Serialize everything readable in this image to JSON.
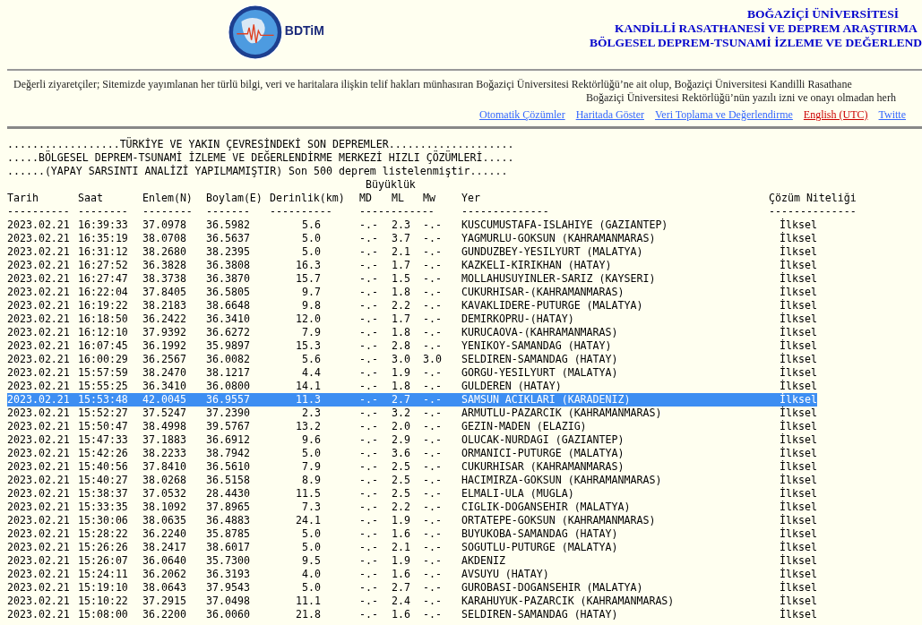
{
  "header": {
    "logo_text": "BDTiM",
    "titles": [
      "BOĞAZİÇİ ÜNİVERSİTESİ",
      "KANDİLLİ RASATHANESİ VE DEPREM ARAŞTIRMA",
      "BÖLGESEL DEPREM-TSUNAMİ İZLEME VE DEĞERLEND"
    ]
  },
  "notice": [
    "Değerli ziyaretçiler; Sitemizde yayımlanan her türlü bilgi, veri ve haritalara ilişkin telif hakları münhasıran Boğaziçi Üniversitesi Rektörlüğü’ne ait olup, Boğaziçi Üniversitesi Kandilli Rasathane",
    "Boğaziçi Üniversitesi Rektörlüğü’nün yazılı izni ve onayı olmadan herh"
  ],
  "links": [
    {
      "label": "Otomatik Çözümler",
      "kind": "nav"
    },
    {
      "label": "Haritada Göster",
      "kind": "nav"
    },
    {
      "label": "Veri Toplama ve Değerlendirme",
      "kind": "nav"
    },
    {
      "label": "English (UTC)",
      "kind": "language"
    },
    {
      "label": "Twitte",
      "kind": "nav"
    }
  ],
  "list_titles": [
    "..................TÜRKİYE VE YAKIN ÇEVRESİNDEKİ SON DEPREMLER....................",
    ".....BÖLGESEL DEPREM-TSUNAMİ İZLEME VE DEĞERLENDİRME MERKEZİ HIZLI ÇÖZÜMLERİ.....",
    "......(YAPAY SARSINTI ANALİZİ YAPILMAMIŞTIR) Son 500 deprem listelenmiştir......"
  ],
  "table": {
    "group_header": "Büyüklük",
    "columns": [
      "Tarih",
      "Saat",
      "Enlem(N)",
      "Boylam(E)",
      "Derinlik(km)",
      "MD",
      "ML",
      "Mw",
      "Yer",
      "Çözüm Niteliği"
    ],
    "separators": [
      "----------",
      "--------",
      "--------",
      "-------",
      "----------",
      "------------",
      "--------------",
      "--------------"
    ],
    "rows": [
      {
        "cells": [
          "2023.02.21",
          "16:39:33",
          "37.0978",
          "36.5982",
          "5.6",
          "-.-",
          "2.3",
          "-.-",
          "KUSCUMUSTAFA-ISLAHIYE (GAZIANTEP)",
          "İlksel"
        ],
        "selected": false
      },
      {
        "cells": [
          "2023.02.21",
          "16:35:19",
          "38.0708",
          "36.5637",
          "5.0",
          "-.-",
          "3.7",
          "-.-",
          "YAGMURLU-GOKSUN (KAHRAMANMARAS)",
          "İlksel"
        ],
        "selected": false
      },
      {
        "cells": [
          "2023.02.21",
          "16:31:12",
          "38.2680",
          "38.2395",
          "5.0",
          "-.-",
          "2.1",
          "-.-",
          "GUNDUZBEY-YESILYURT (MALATYA)",
          "İlksel"
        ],
        "selected": false
      },
      {
        "cells": [
          "2023.02.21",
          "16:27:52",
          "36.3828",
          "36.3808",
          "16.3",
          "-.-",
          "1.7",
          "-.-",
          "KAZKELI-KIRIKHAN (HATAY)",
          "İlksel"
        ],
        "selected": false
      },
      {
        "cells": [
          "2023.02.21",
          "16:27:47",
          "38.3738",
          "36.3870",
          "15.7",
          "-.-",
          "1.5",
          "-.-",
          "MOLLAHUSUYINLER-SARIZ (KAYSERI)",
          "İlksel"
        ],
        "selected": false
      },
      {
        "cells": [
          "2023.02.21",
          "16:22:04",
          "37.8405",
          "36.5805",
          "9.7",
          "-.-",
          "1.8",
          "-.-",
          "CUKURHISAR-(KAHRAMANMARAS)",
          "İlksel"
        ],
        "selected": false
      },
      {
        "cells": [
          "2023.02.21",
          "16:19:22",
          "38.2183",
          "38.6648",
          "9.8",
          "-.-",
          "2.2",
          "-.-",
          "KAVAKLIDERE-PUTURGE (MALATYA)",
          "İlksel"
        ],
        "selected": false
      },
      {
        "cells": [
          "2023.02.21",
          "16:18:50",
          "36.2422",
          "36.3410",
          "12.0",
          "-.-",
          "1.7",
          "-.-",
          "DEMIRKOPRU-(HATAY)",
          "İlksel"
        ],
        "selected": false
      },
      {
        "cells": [
          "2023.02.21",
          "16:12:10",
          "37.9392",
          "36.6272",
          "7.9",
          "-.-",
          "1.8",
          "-.-",
          "KURUCAOVA-(KAHRAMANMARAS)",
          "İlksel"
        ],
        "selected": false
      },
      {
        "cells": [
          "2023.02.21",
          "16:07:45",
          "36.1992",
          "35.9897",
          "15.3",
          "-.-",
          "2.8",
          "-.-",
          "YENIKOY-SAMANDAG (HATAY)",
          "İlksel"
        ],
        "selected": false
      },
      {
        "cells": [
          "2023.02.21",
          "16:00:29",
          "36.2567",
          "36.0082",
          "5.6",
          "-.-",
          "3.0",
          "3.0",
          "SELDIREN-SAMANDAG (HATAY)",
          "İlksel"
        ],
        "selected": false
      },
      {
        "cells": [
          "2023.02.21",
          "15:57:59",
          "38.2470",
          "38.1217",
          "4.4",
          "-.-",
          "1.9",
          "-.-",
          "GORGU-YESILYURT (MALATYA)",
          "İlksel"
        ],
        "selected": false
      },
      {
        "cells": [
          "2023.02.21",
          "15:55:25",
          "36.3410",
          "36.0800",
          "14.1",
          "-.-",
          "1.8",
          "-.-",
          "GULDEREN (HATAY)",
          "İlksel"
        ],
        "selected": false
      },
      {
        "cells": [
          "2023.02.21",
          "15:53:48",
          "42.0045",
          "36.9557",
          "11.3",
          "-.-",
          "2.7",
          "-.-",
          "SAMSUN ACIKLARI (KARADENIZ)",
          "İlksel"
        ],
        "selected": true
      },
      {
        "cells": [
          "2023.02.21",
          "15:52:27",
          "37.5247",
          "37.2390",
          "2.3",
          "-.-",
          "3.2",
          "-.-",
          "ARMUTLU-PAZARCIK (KAHRAMANMARAS)",
          "İlksel"
        ],
        "selected": false
      },
      {
        "cells": [
          "2023.02.21",
          "15:50:47",
          "38.4998",
          "39.5767",
          "13.2",
          "-.-",
          "2.0",
          "-.-",
          "GEZIN-MADEN (ELAZIG)",
          "İlksel"
        ],
        "selected": false
      },
      {
        "cells": [
          "2023.02.21",
          "15:47:33",
          "37.1883",
          "36.6912",
          "9.6",
          "-.-",
          "2.9",
          "-.-",
          "OLUCAK-NURDAGI (GAZIANTEP)",
          "İlksel"
        ],
        "selected": false
      },
      {
        "cells": [
          "2023.02.21",
          "15:42:26",
          "38.2233",
          "38.7942",
          "5.0",
          "-.-",
          "3.6",
          "-.-",
          "ORMANICI-PUTURGE (MALATYA)",
          "İlksel"
        ],
        "selected": false
      },
      {
        "cells": [
          "2023.02.21",
          "15:40:56",
          "37.8410",
          "36.5610",
          "7.9",
          "-.-",
          "2.5",
          "-.-",
          "CUKURHISAR (KAHRAMANMARAS)",
          "İlksel"
        ],
        "selected": false
      },
      {
        "cells": [
          "2023.02.21",
          "15:40:27",
          "38.0268",
          "36.5158",
          "8.9",
          "-.-",
          "2.5",
          "-.-",
          "HACIMIRZA-GOKSUN (KAHRAMANMARAS)",
          "İlksel"
        ],
        "selected": false
      },
      {
        "cells": [
          "2023.02.21",
          "15:38:37",
          "37.0532",
          "28.4430",
          "11.5",
          "-.-",
          "2.5",
          "-.-",
          "ELMALI-ULA (MUGLA)",
          "İlksel"
        ],
        "selected": false
      },
      {
        "cells": [
          "2023.02.21",
          "15:33:35",
          "38.1092",
          "37.8965",
          "7.3",
          "-.-",
          "2.2",
          "-.-",
          "CIGLIK-DOGANSEHIR (MALATYA)",
          "İlksel"
        ],
        "selected": false
      },
      {
        "cells": [
          "2023.02.21",
          "15:30:06",
          "38.0635",
          "36.4883",
          "24.1",
          "-.-",
          "1.9",
          "-.-",
          "ORTATEPE-GOKSUN (KAHRAMANMARAS)",
          "İlksel"
        ],
        "selected": false
      },
      {
        "cells": [
          "2023.02.21",
          "15:28:22",
          "36.2240",
          "35.8785",
          "5.0",
          "-.-",
          "1.6",
          "-.-",
          "BUYUKOBA-SAMANDAG (HATAY)",
          "İlksel"
        ],
        "selected": false
      },
      {
        "cells": [
          "2023.02.21",
          "15:26:26",
          "38.2417",
          "38.6017",
          "5.0",
          "-.-",
          "2.1",
          "-.-",
          "SOGUTLU-PUTURGE (MALATYA)",
          "İlksel"
        ],
        "selected": false
      },
      {
        "cells": [
          "2023.02.21",
          "15:26:07",
          "36.0640",
          "35.7300",
          "9.5",
          "-.-",
          "1.9",
          "-.-",
          "AKDENIZ",
          "İlksel"
        ],
        "selected": false
      },
      {
        "cells": [
          "2023.02.21",
          "15:24:11",
          "36.2062",
          "36.3193",
          "4.0",
          "-.-",
          "1.6",
          "-.-",
          "AVSUYU (HATAY)",
          "İlksel"
        ],
        "selected": false
      },
      {
        "cells": [
          "2023.02.21",
          "15:19:10",
          "38.0643",
          "37.9543",
          "5.0",
          "-.-",
          "2.7",
          "-.-",
          "GUROBASI-DOGANSEHIR (MALATYA)",
          "İlksel"
        ],
        "selected": false
      },
      {
        "cells": [
          "2023.02.21",
          "15:10:22",
          "37.2915",
          "37.0498",
          "11.1",
          "-.-",
          "2.4",
          "-.-",
          "KARAHUYUK-PAZARCIK (KAHRAMANMARAS)",
          "İlksel"
        ],
        "selected": false
      },
      {
        "cells": [
          "2023.02.21",
          "15:08:00",
          "36.2200",
          "36.0060",
          "21.8",
          "-.-",
          "1.6",
          "-.-",
          "SELDIREN-SAMANDAG (HATAY)",
          "İlksel"
        ],
        "selected": false
      }
    ]
  }
}
